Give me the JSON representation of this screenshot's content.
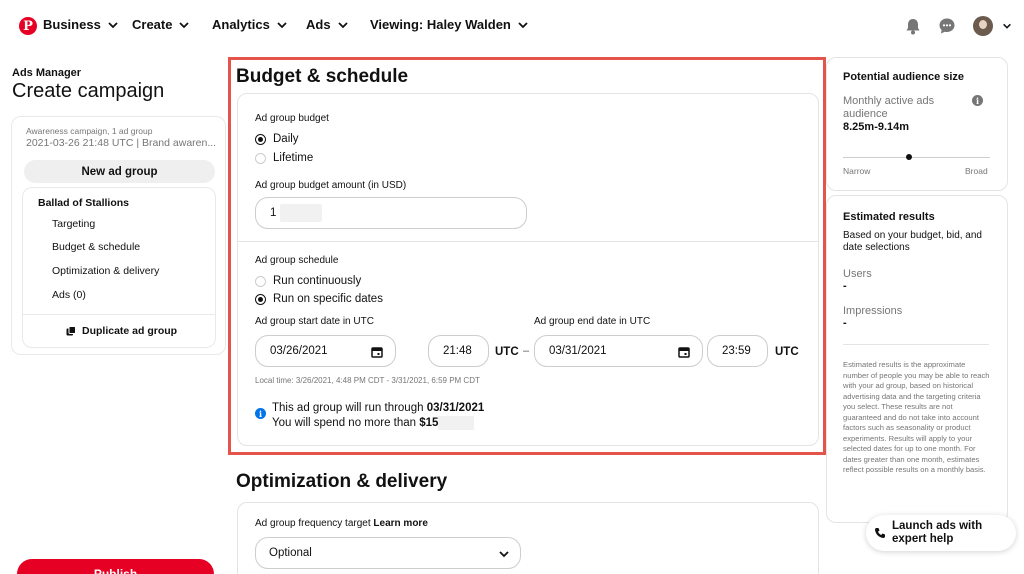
{
  "nav": {
    "logo": "P",
    "business": "Business",
    "create": "Create",
    "analytics": "Analytics",
    "ads": "Ads",
    "viewing": "Viewing: Haley Walden"
  },
  "left": {
    "ads_manager": "Ads Manager",
    "create_campaign": "Create campaign",
    "campaign_line1": "Awareness campaign, 1 ad group",
    "campaign_line2": "2021-03-26 21:48 UTC | Brand awaren...",
    "new_ad_group": "New ad group",
    "ad_group_name": "Ballad of Stallions",
    "items": [
      "Targeting",
      "Budget & schedule",
      "Optimization & delivery",
      "Ads (0)"
    ],
    "duplicate": "Duplicate ad group",
    "publish": "Publish"
  },
  "budget": {
    "title": "Budget & schedule",
    "budget_label": "Ad group budget",
    "daily": "Daily",
    "lifetime": "Lifetime",
    "selected": "Daily",
    "amount_label": "Ad group budget amount (in USD)",
    "amount_value": "1",
    "schedule_label": "Ad group schedule",
    "run_continuously": "Run continuously",
    "run_specific": "Run on specific dates",
    "schedule_selected": "Run on specific dates",
    "start_label": "Ad group start date in UTC",
    "end_label": "Ad group end date in UTC",
    "start_date": "03/26/2021",
    "start_time": "21:48",
    "end_date": "03/31/2021",
    "end_time": "23:59",
    "utc": "UTC",
    "dash": "–",
    "local_time": "Local time: 3/26/2021, 4:48 PM CDT - 3/31/2021, 6:59 PM CDT",
    "info_prefix": "This ad group will run through ",
    "info_date": "03/31/2021",
    "info_spend_prefix": "You will spend no more than ",
    "info_spend_value": "$15"
  },
  "optimization": {
    "title": "Optimization & delivery",
    "freq_label": "Ad group frequency target ",
    "learn_more": "Learn more",
    "select_value": "Optional"
  },
  "audience": {
    "title": "Potential audience size",
    "monthly_label": "Monthly active ads audience",
    "monthly_value": "8.25m-9.14m",
    "narrow": "Narrow",
    "broad": "Broad",
    "range_level": 0.45
  },
  "estimated": {
    "title": "Estimated results",
    "subtitle": "Based on your budget, bid, and date selections",
    "users_label": "Users",
    "users_value": "-",
    "impressions_label": "Impressions",
    "impressions_value": "-",
    "disclaimer": "Estimated results is the approximate number of people you may be able to reach with your ad group, based on historical advertising data and the targeting criteria you select. These results are not guaranteed and do not take into account factors such as seasonality or product experiments. Results will apply to your selected dates for up to one month. For dates greater than one month, estimates reflect possible results on a monthly basis."
  },
  "launch": {
    "line1": "Launch ads with",
    "line2": "expert help"
  },
  "colors": {
    "brand": "#e60023",
    "highlight": "#e4544a",
    "info": "#0074e8"
  },
  "icons": [
    "pinterest-logo-icon",
    "bell-icon",
    "chat-icon",
    "avatar",
    "calendar-icon",
    "info-icon",
    "duplicate-icon",
    "phone-icon",
    "chevron-down-icon"
  ]
}
